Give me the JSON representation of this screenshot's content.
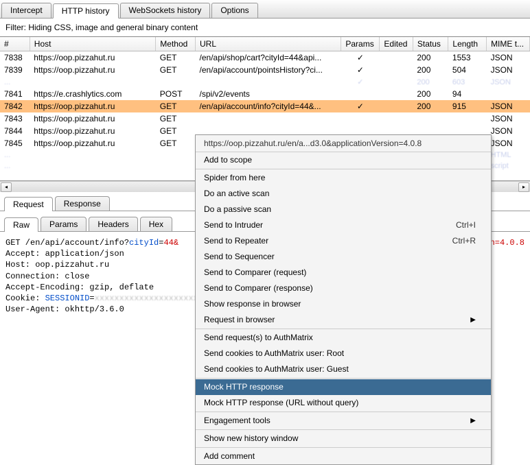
{
  "tabs": [
    "Intercept",
    "HTTP history",
    "WebSockets history",
    "Options"
  ],
  "activeTab": 1,
  "filterText": "Filter: Hiding CSS, image and general binary content",
  "columns": [
    "#",
    "Host",
    "Method",
    "URL",
    "Params",
    "Edited",
    "Status",
    "Length",
    "MIME t..."
  ],
  "rows": [
    {
      "num": "7838",
      "host": "https://oop.pizzahut.ru",
      "method": "GET",
      "url": "/en/api/shop/cart?cityId=44&api...",
      "params": "✓",
      "edited": "",
      "status": "200",
      "length": "1553",
      "mime": "JSON",
      "sel": false,
      "blur": false
    },
    {
      "num": "7839",
      "host": "https://oop.pizzahut.ru",
      "method": "GET",
      "url": "/en/api/account/pointsHistory?ci...",
      "params": "✓",
      "edited": "",
      "status": "200",
      "length": "504",
      "mime": "JSON",
      "sel": false,
      "blur": false
    },
    {
      "num": "...",
      "host": "  ",
      "method": " ",
      "url": "  ",
      "params": "✓",
      "edited": "",
      "status": "200",
      "length": "603",
      "mime": "JSON",
      "sel": false,
      "blur": true
    },
    {
      "num": "7841",
      "host": "https://e.crashlytics.com",
      "method": "POST",
      "url": "/spi/v2/events",
      "params": "",
      "edited": "",
      "status": "200",
      "length": "94",
      "mime": "",
      "sel": false,
      "blur": false
    },
    {
      "num": "7842",
      "host": "https://oop.pizzahut.ru",
      "method": "GET",
      "url": "/en/api/account/info?cityId=44&...",
      "params": "✓",
      "edited": "",
      "status": "200",
      "length": "915",
      "mime": "JSON",
      "sel": true,
      "blur": false
    },
    {
      "num": "7843",
      "host": "https://oop.pizzahut.ru",
      "method": "GET",
      "url": "",
      "params": "",
      "edited": "",
      "status": "",
      "length": "",
      "mime": "JSON",
      "sel": false,
      "blur": false
    },
    {
      "num": "7844",
      "host": "https://oop.pizzahut.ru",
      "method": "GET",
      "url": "",
      "params": "",
      "edited": "",
      "status": "",
      "length": "",
      "mime": "JSON",
      "sel": false,
      "blur": false
    },
    {
      "num": "7845",
      "host": "https://oop.pizzahut.ru",
      "method": "GET",
      "url": "",
      "params": "",
      "edited": "",
      "status": "",
      "length": "",
      "mime": "JSON",
      "sel": false,
      "blur": false
    },
    {
      "num": "...",
      "host": "  ",
      "method": " ",
      "url": " ",
      "params": "",
      "edited": "",
      "status": "",
      "length": "",
      "mime": "HTML",
      "sel": false,
      "blur": true
    },
    {
      "num": "...",
      "host": "  ",
      "method": " ",
      "url": " ",
      "params": "",
      "edited": "",
      "status": "",
      "length": "",
      "mime": "script",
      "sel": false,
      "blur": true
    }
  ],
  "reqRespTabs": [
    "Request",
    "Response"
  ],
  "reqRespActive": 0,
  "rawTabs": [
    "Raw",
    "Params",
    "Headers",
    "Hex"
  ],
  "rawActive": 0,
  "rawRequest": {
    "line1_a": "GET /en/api/account/info?",
    "line1_b": "cityId",
    "line1_c": "=",
    "line1_d": "44&",
    "line2": "Accept: application/json",
    "line3": "Host: oop.pizzahut.ru",
    "line4": "Connection: close",
    "line5": "Accept-Encoding: gzip, deflate",
    "line6_a": "Cookie: ",
    "line6_b": "SESSIONID",
    "line6_c": "=",
    "line7": "User-Agent: okhttp/3.6.0",
    "right_frag": "n=4.0.8"
  },
  "contextMenu": {
    "title": "https://oop.pizzahut.ru/en/a...d3.0&applicationVersion=4.0.8",
    "items": [
      {
        "label": "Add to scope",
        "shortcut": "",
        "sub": false
      },
      {
        "sep": true
      },
      {
        "label": "Spider from here",
        "shortcut": "",
        "sub": false
      },
      {
        "label": "Do an active scan",
        "shortcut": "",
        "sub": false
      },
      {
        "label": "Do a passive scan",
        "shortcut": "",
        "sub": false
      },
      {
        "label": "Send to Intruder",
        "shortcut": "Ctrl+I",
        "sub": false
      },
      {
        "label": "Send to Repeater",
        "shortcut": "Ctrl+R",
        "sub": false
      },
      {
        "label": "Send to Sequencer",
        "shortcut": "",
        "sub": false
      },
      {
        "label": "Send to Comparer (request)",
        "shortcut": "",
        "sub": false
      },
      {
        "label": "Send to Comparer (response)",
        "shortcut": "",
        "sub": false
      },
      {
        "label": "Show response in browser",
        "shortcut": "",
        "sub": false
      },
      {
        "label": "Request in browser",
        "shortcut": "",
        "sub": true
      },
      {
        "sep": true
      },
      {
        "label": "Send request(s) to AuthMatrix",
        "shortcut": "",
        "sub": false
      },
      {
        "label": "Send cookies to AuthMatrix user: Root",
        "shortcut": "",
        "sub": false
      },
      {
        "label": "Send cookies to AuthMatrix user: Guest",
        "shortcut": "",
        "sub": false
      },
      {
        "sep": true
      },
      {
        "label": "Mock HTTP response",
        "shortcut": "",
        "sub": false,
        "hl": true
      },
      {
        "label": "Mock HTTP response (URL without query)",
        "shortcut": "",
        "sub": false
      },
      {
        "sep": true
      },
      {
        "label": "Engagement tools",
        "shortcut": "",
        "sub": true
      },
      {
        "sep": true
      },
      {
        "label": "Show new history window",
        "shortcut": "",
        "sub": false
      },
      {
        "sep": true
      },
      {
        "label": "Add comment",
        "shortcut": "",
        "sub": false
      }
    ]
  }
}
